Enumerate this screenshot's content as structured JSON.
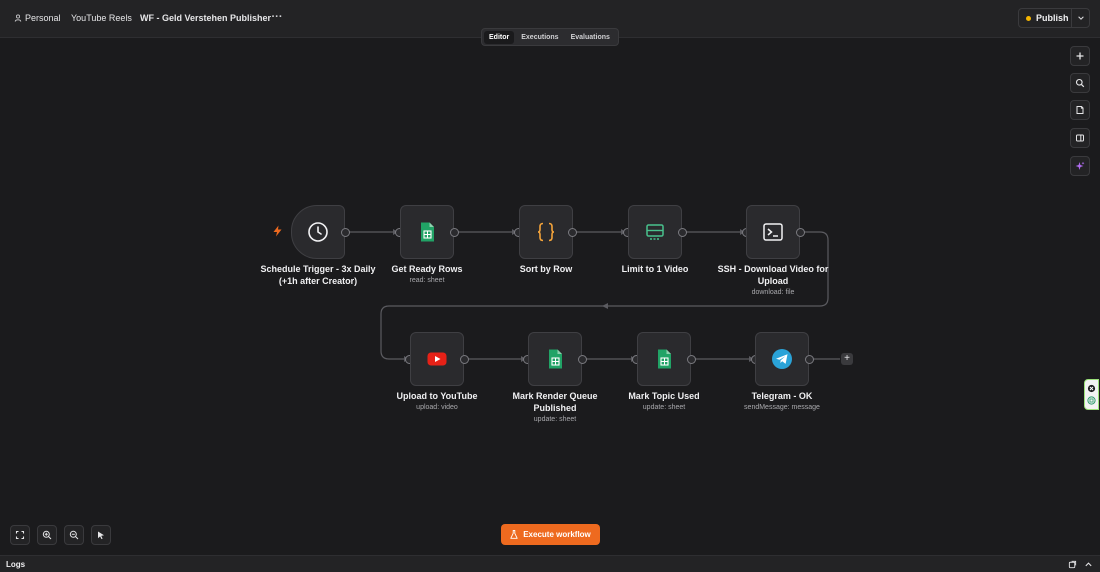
{
  "topbar": {
    "personal_label": "Personal",
    "folder_label": "YouTube Reels",
    "workflow_name": "WF - Geld Verstehen Publisher",
    "more_label": "···",
    "publish_label": "Publish"
  },
  "tabs": [
    {
      "label": "Editor",
      "active": true
    },
    {
      "label": "Executions",
      "active": false
    },
    {
      "label": "Evaluations",
      "active": false
    }
  ],
  "right_rail": [
    "plus-icon",
    "search-icon",
    "sticky-note-icon",
    "panel-icon",
    "ai-sparkle-icon"
  ],
  "nodes": [
    {
      "title": "Schedule Trigger - 3x Daily (+1h after Creator)",
      "subtitle": "",
      "icon": "clock-icon"
    },
    {
      "title": "Get Ready Rows",
      "subtitle": "read: sheet",
      "icon": "google-sheets-icon"
    },
    {
      "title": "Sort by Row",
      "subtitle": "",
      "icon": "code-braces-icon"
    },
    {
      "title": "Limit to 1 Video",
      "subtitle": "",
      "icon": "limit-icon"
    },
    {
      "title": "SSH - Download Video for Upload",
      "subtitle": "download: file",
      "icon": "terminal-icon"
    },
    {
      "title": "Upload to YouTube",
      "subtitle": "upload: video",
      "icon": "youtube-icon"
    },
    {
      "title": "Mark Render Queue Published",
      "subtitle": "update: sheet",
      "icon": "google-sheets-icon"
    },
    {
      "title": "Mark Topic Used",
      "subtitle": "update: sheet",
      "icon": "google-sheets-icon"
    },
    {
      "title": "Telegram - OK",
      "subtitle": "sendMessage: message",
      "icon": "telegram-icon"
    }
  ],
  "add_node_label": "+",
  "bottom": {
    "execute_label": "Execute workflow",
    "zoom_controls": [
      "fit-view-icon",
      "zoom-in-icon",
      "zoom-out-icon",
      "pointer-icon"
    ]
  },
  "logs": {
    "label": "Logs"
  },
  "colors": {
    "accent": "#ee6a1f",
    "sheets_green": "#21a366",
    "youtube_red": "#e62117",
    "telegram_blue": "#2aa3d8",
    "braces_orange": "#f3a33a",
    "limit_green": "#49c18d",
    "publish_dot": "#f4b400",
    "canvas_bg": "#1b1b1d"
  }
}
